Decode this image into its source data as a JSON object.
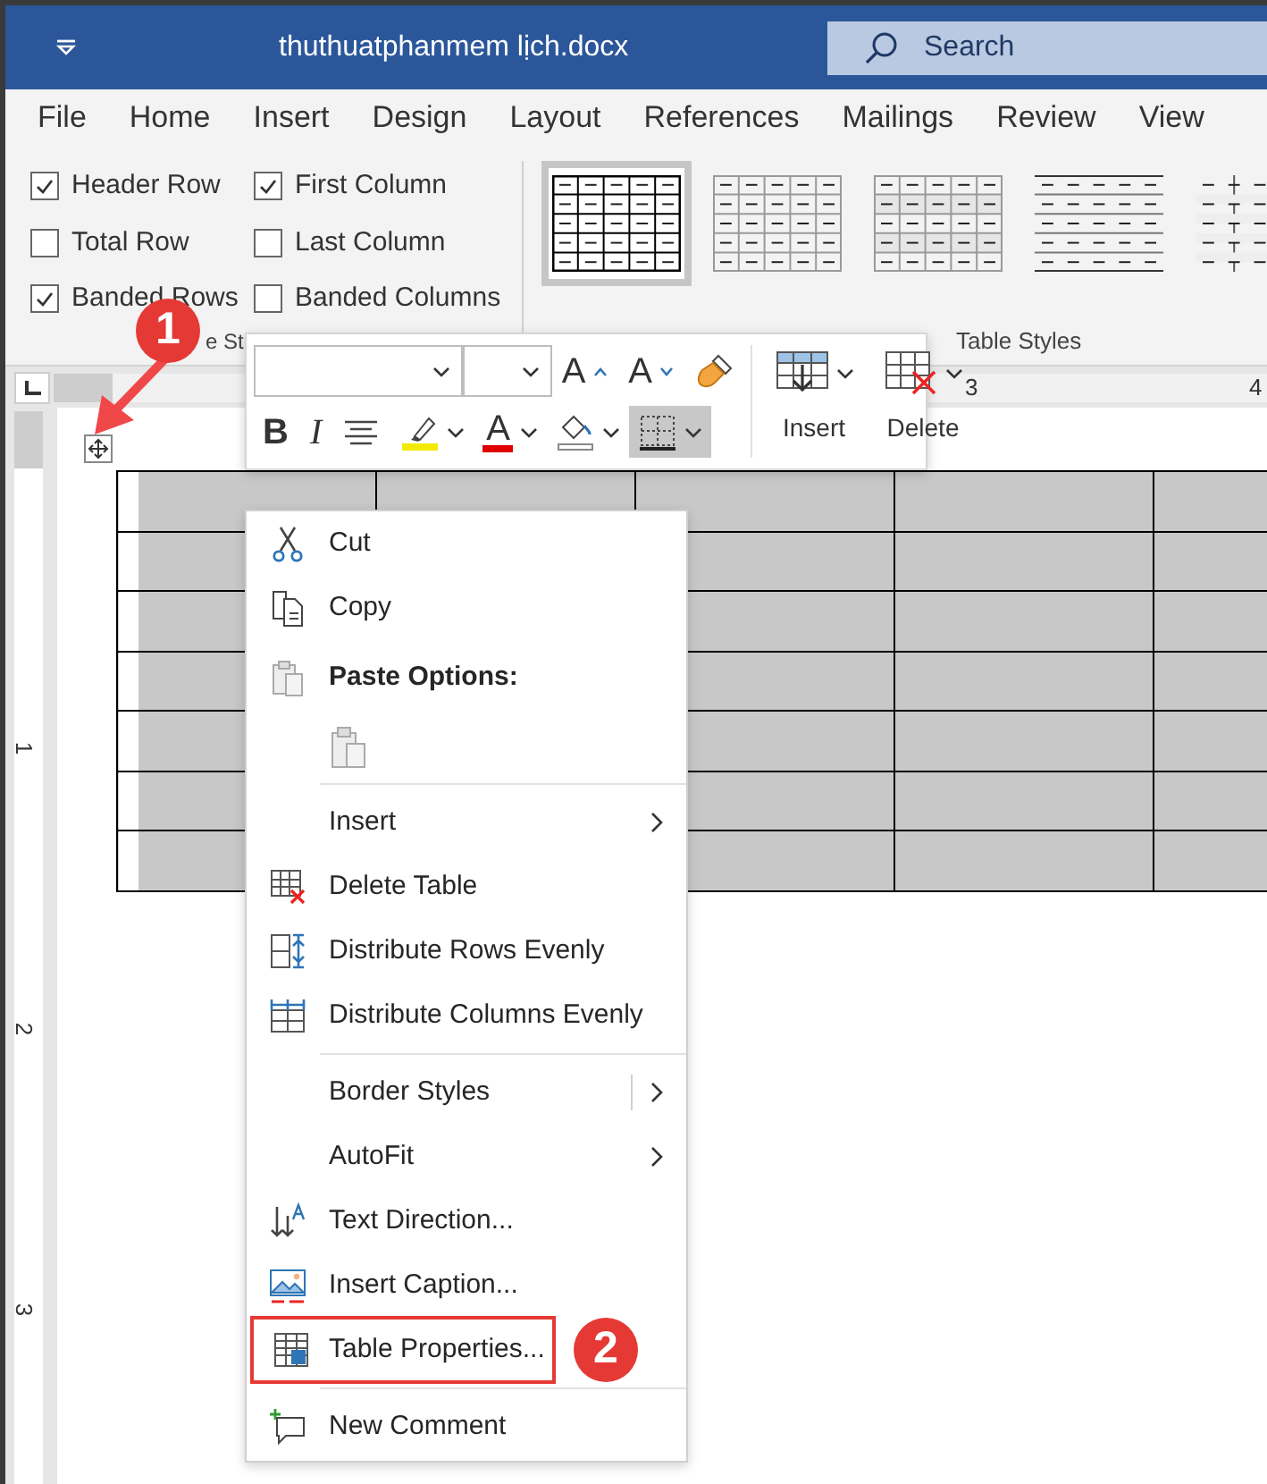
{
  "window": {
    "title": "thuthuatphanmem lịch.docx",
    "search_placeholder": "Search"
  },
  "ribbon_tabs": [
    "File",
    "Home",
    "Insert",
    "Design",
    "Layout",
    "References",
    "Mailings",
    "Review",
    "View"
  ],
  "style_options": {
    "items": [
      {
        "label": "Header Row",
        "checked": true
      },
      {
        "label": "First Column",
        "checked": true
      },
      {
        "label": "Total Row",
        "checked": false
      },
      {
        "label": "Last Column",
        "checked": false
      },
      {
        "label": "Banded Rows",
        "checked": true
      },
      {
        "label": "Banded Columns",
        "checked": false
      }
    ],
    "group_label": "e St"
  },
  "table_styles": {
    "items": [
      {
        "kind": "grid-dark",
        "selected": true
      },
      {
        "kind": "grid-light",
        "selected": false
      },
      {
        "kind": "grid-banded",
        "selected": false
      },
      {
        "kind": "lines",
        "selected": false
      },
      {
        "kind": "partial",
        "selected": false
      }
    ],
    "group_label": "Table Styles"
  },
  "horizontal_ruler": {
    "numbers": [
      "3",
      "4"
    ]
  },
  "vertical_ruler": {
    "numbers": [
      "1",
      "2",
      "3"
    ]
  },
  "document_table": {
    "shaded": true,
    "move_handle": {
      "step_badge": "1",
      "pointer_arrow": true
    }
  },
  "mini_toolbar": {
    "rows": [
      [
        {
          "kind": "font-box",
          "pressed": false
        },
        {
          "kind": "size-box",
          "pressed": false
        },
        {
          "kind": "grow-font",
          "glyph": "A",
          "pressed": false
        },
        {
          "kind": "shrink-font",
          "glyph": "A",
          "pressed": false
        },
        {
          "kind": "format-painter",
          "pressed": false
        }
      ],
      [
        {
          "kind": "bold",
          "glyph": "B",
          "pressed": false
        },
        {
          "kind": "italic",
          "glyph": "I",
          "pressed": false
        },
        {
          "kind": "align-center",
          "pressed": false
        },
        {
          "kind": "highlight",
          "dropdown": true,
          "pressed": false
        },
        {
          "kind": "font-color",
          "glyph": "A",
          "dropdown": true,
          "pressed": false
        },
        {
          "kind": "shading",
          "dropdown": true,
          "pressed": false
        },
        {
          "kind": "borders",
          "dropdown": true,
          "pressed": true
        }
      ]
    ],
    "table_buttons": [
      {
        "kind": "insert",
        "label": "Insert"
      },
      {
        "kind": "delete",
        "label": "Delete"
      }
    ]
  },
  "context_menu": [
    {
      "kind": "cut",
      "label": "Cut",
      "submenu": false,
      "highlighted": false
    },
    {
      "kind": "copy",
      "label": "Copy",
      "submenu": false,
      "highlighted": false
    },
    {
      "kind": "paste-heading",
      "label": "Paste Options:"
    },
    {
      "kind": "paste-option"
    },
    {
      "kind": "separator"
    },
    {
      "kind": "plain",
      "label": "Insert",
      "submenu": true,
      "highlighted": false
    },
    {
      "kind": "delete-table",
      "label": "Delete Table",
      "submenu": false,
      "highlighted": false
    },
    {
      "kind": "distribute-rows",
      "label": "Distribute Rows Evenly",
      "submenu": false,
      "highlighted": false
    },
    {
      "kind": "distribute-columns",
      "label": "Distribute Columns Evenly",
      "submenu": false,
      "highlighted": false
    },
    {
      "kind": "separator"
    },
    {
      "kind": "plain",
      "label": "Border Styles",
      "submenu": true,
      "split": true,
      "highlighted": false
    },
    {
      "kind": "plain",
      "label": "AutoFit",
      "submenu": true,
      "highlighted": false
    },
    {
      "kind": "text-direction",
      "label": "Text Direction...",
      "submenu": false,
      "highlighted": false
    },
    {
      "kind": "insert-caption",
      "label": "Insert Caption...",
      "submenu": false,
      "highlighted": false
    },
    {
      "kind": "table-properties",
      "label": "Table Properties...",
      "submenu": false,
      "highlighted": true,
      "step_badge": "2"
    },
    {
      "kind": "separator"
    },
    {
      "kind": "new-comment",
      "label": "New Comment",
      "submenu": false,
      "highlighted": false
    }
  ]
}
